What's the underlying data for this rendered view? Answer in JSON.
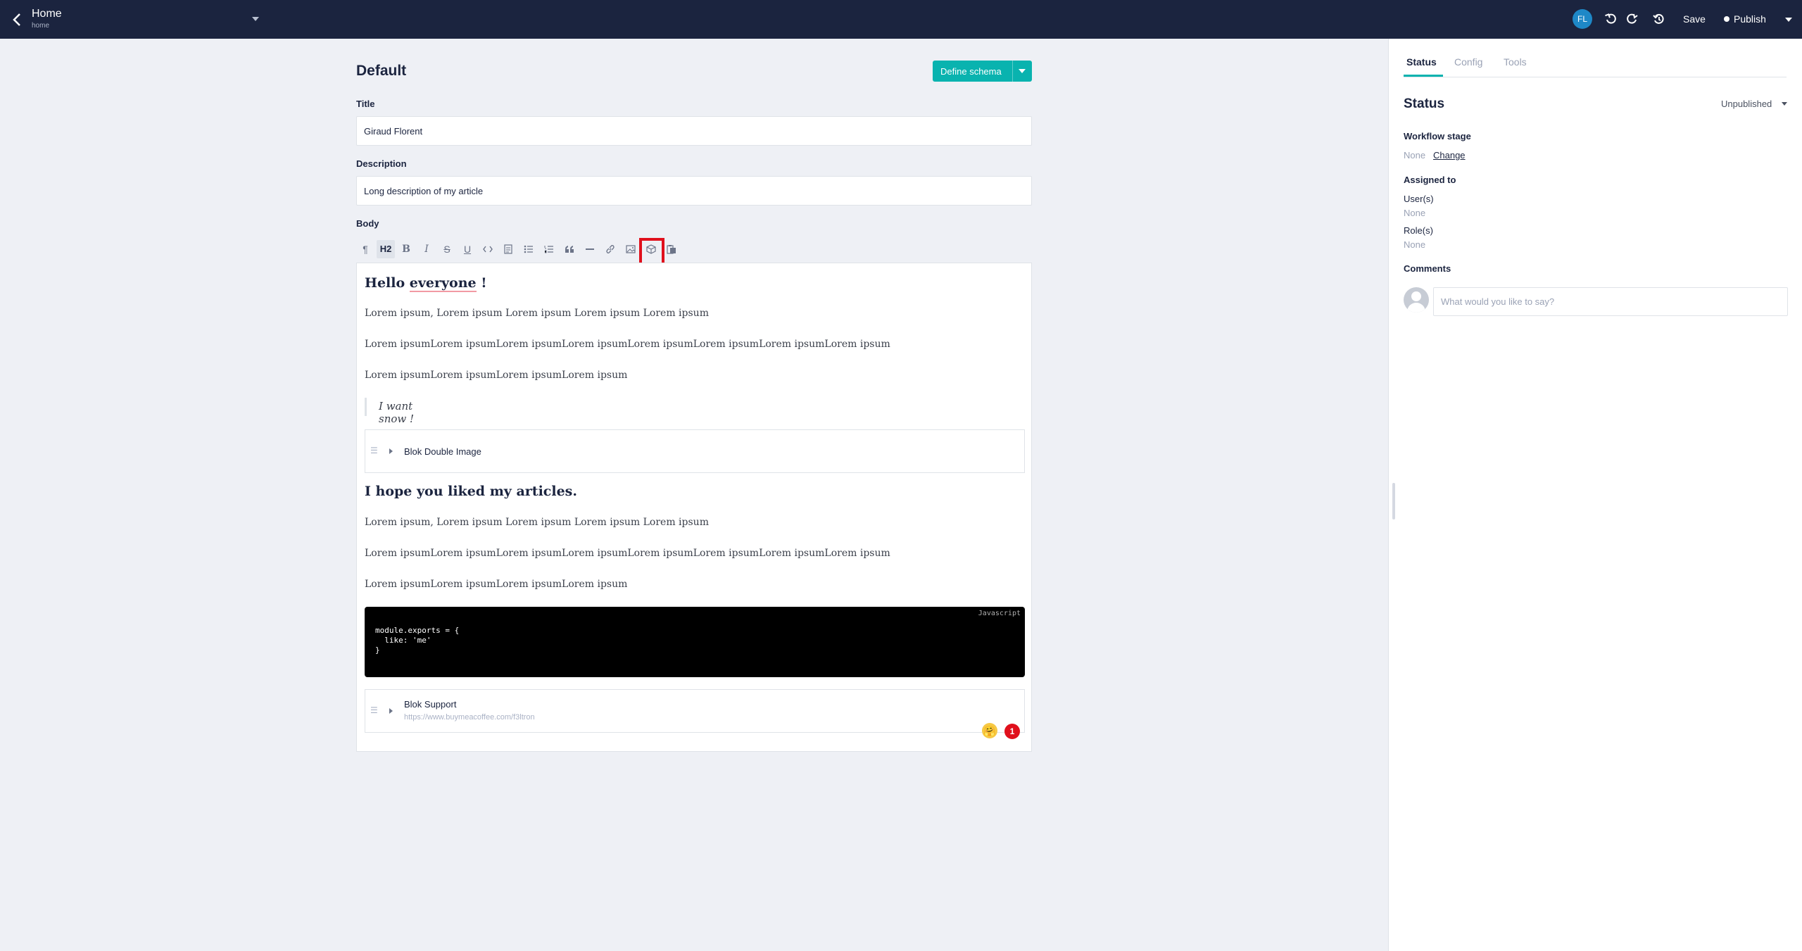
{
  "topbar": {
    "title": "Home",
    "slug": "home",
    "avatar_initials": "FL",
    "save_label": "Save",
    "publish_label": "Publish"
  },
  "main": {
    "section_title": "Default",
    "define_schema_label": "Define schema",
    "fields": {
      "title_label": "Title",
      "title_value": "Giraud Florent",
      "description_label": "Description",
      "description_value": "Long description of my article",
      "body_label": "Body"
    },
    "toolbar": {
      "h2_label": "H2",
      "bold_label": "B",
      "italic_label": "I",
      "strike_label": "S",
      "underline_label": "U",
      "highlighted_tool": "blok-icon"
    },
    "body": {
      "heading1": "Hello ",
      "heading1_underlined": "everyone",
      "heading1_end": " !",
      "p1": "Lorem ipsum, Lorem ipsum Lorem ipsum Lorem ipsum Lorem ipsum",
      "p2": "Lorem ipsumLorem ipsumLorem ipsumLorem ipsumLorem ipsumLorem ipsumLorem ipsumLorem ipsum",
      "p3": "Lorem ipsumLorem ipsumLorem ipsumLorem ipsum",
      "quote": "I want snow !",
      "blok1_name": "Blok Double Image",
      "heading2": "I hope you liked my articles.",
      "p4": "Lorem ipsum, Lorem ipsum Lorem ipsum Lorem ipsum Lorem ipsum",
      "p5": "Lorem ipsumLorem ipsumLorem ipsumLorem ipsumLorem ipsumLorem ipsumLorem ipsumLorem ipsum",
      "p6": "Lorem ipsumLorem ipsumLorem ipsumLorem ipsum",
      "code_language": "Javascript",
      "code": "module.exports = {\n  like: 'me'\n}",
      "blok2_name": "Blok Support",
      "blok2_url": "https://www.buymeacoffee.com/f3ltron",
      "emoji": "🤗",
      "badge_count": "1"
    }
  },
  "sidebar": {
    "tabs": [
      "Status",
      "Config",
      "Tools"
    ],
    "active_tab": "Status",
    "status_title": "Status",
    "publish_state": "Unpublished",
    "workflow_label": "Workflow stage",
    "workflow_value": "None",
    "workflow_change": "Change",
    "assigned_label": "Assigned to",
    "users_label": "User(s)",
    "users_value": "None",
    "roles_label": "Role(s)",
    "roles_value": "None",
    "comments_label": "Comments",
    "comment_placeholder": "What would you like to say?"
  },
  "colors": {
    "topbar": "#1b243f",
    "accent": "#09b3af",
    "highlight": "#e0101c",
    "avatar": "#1e88c7"
  }
}
